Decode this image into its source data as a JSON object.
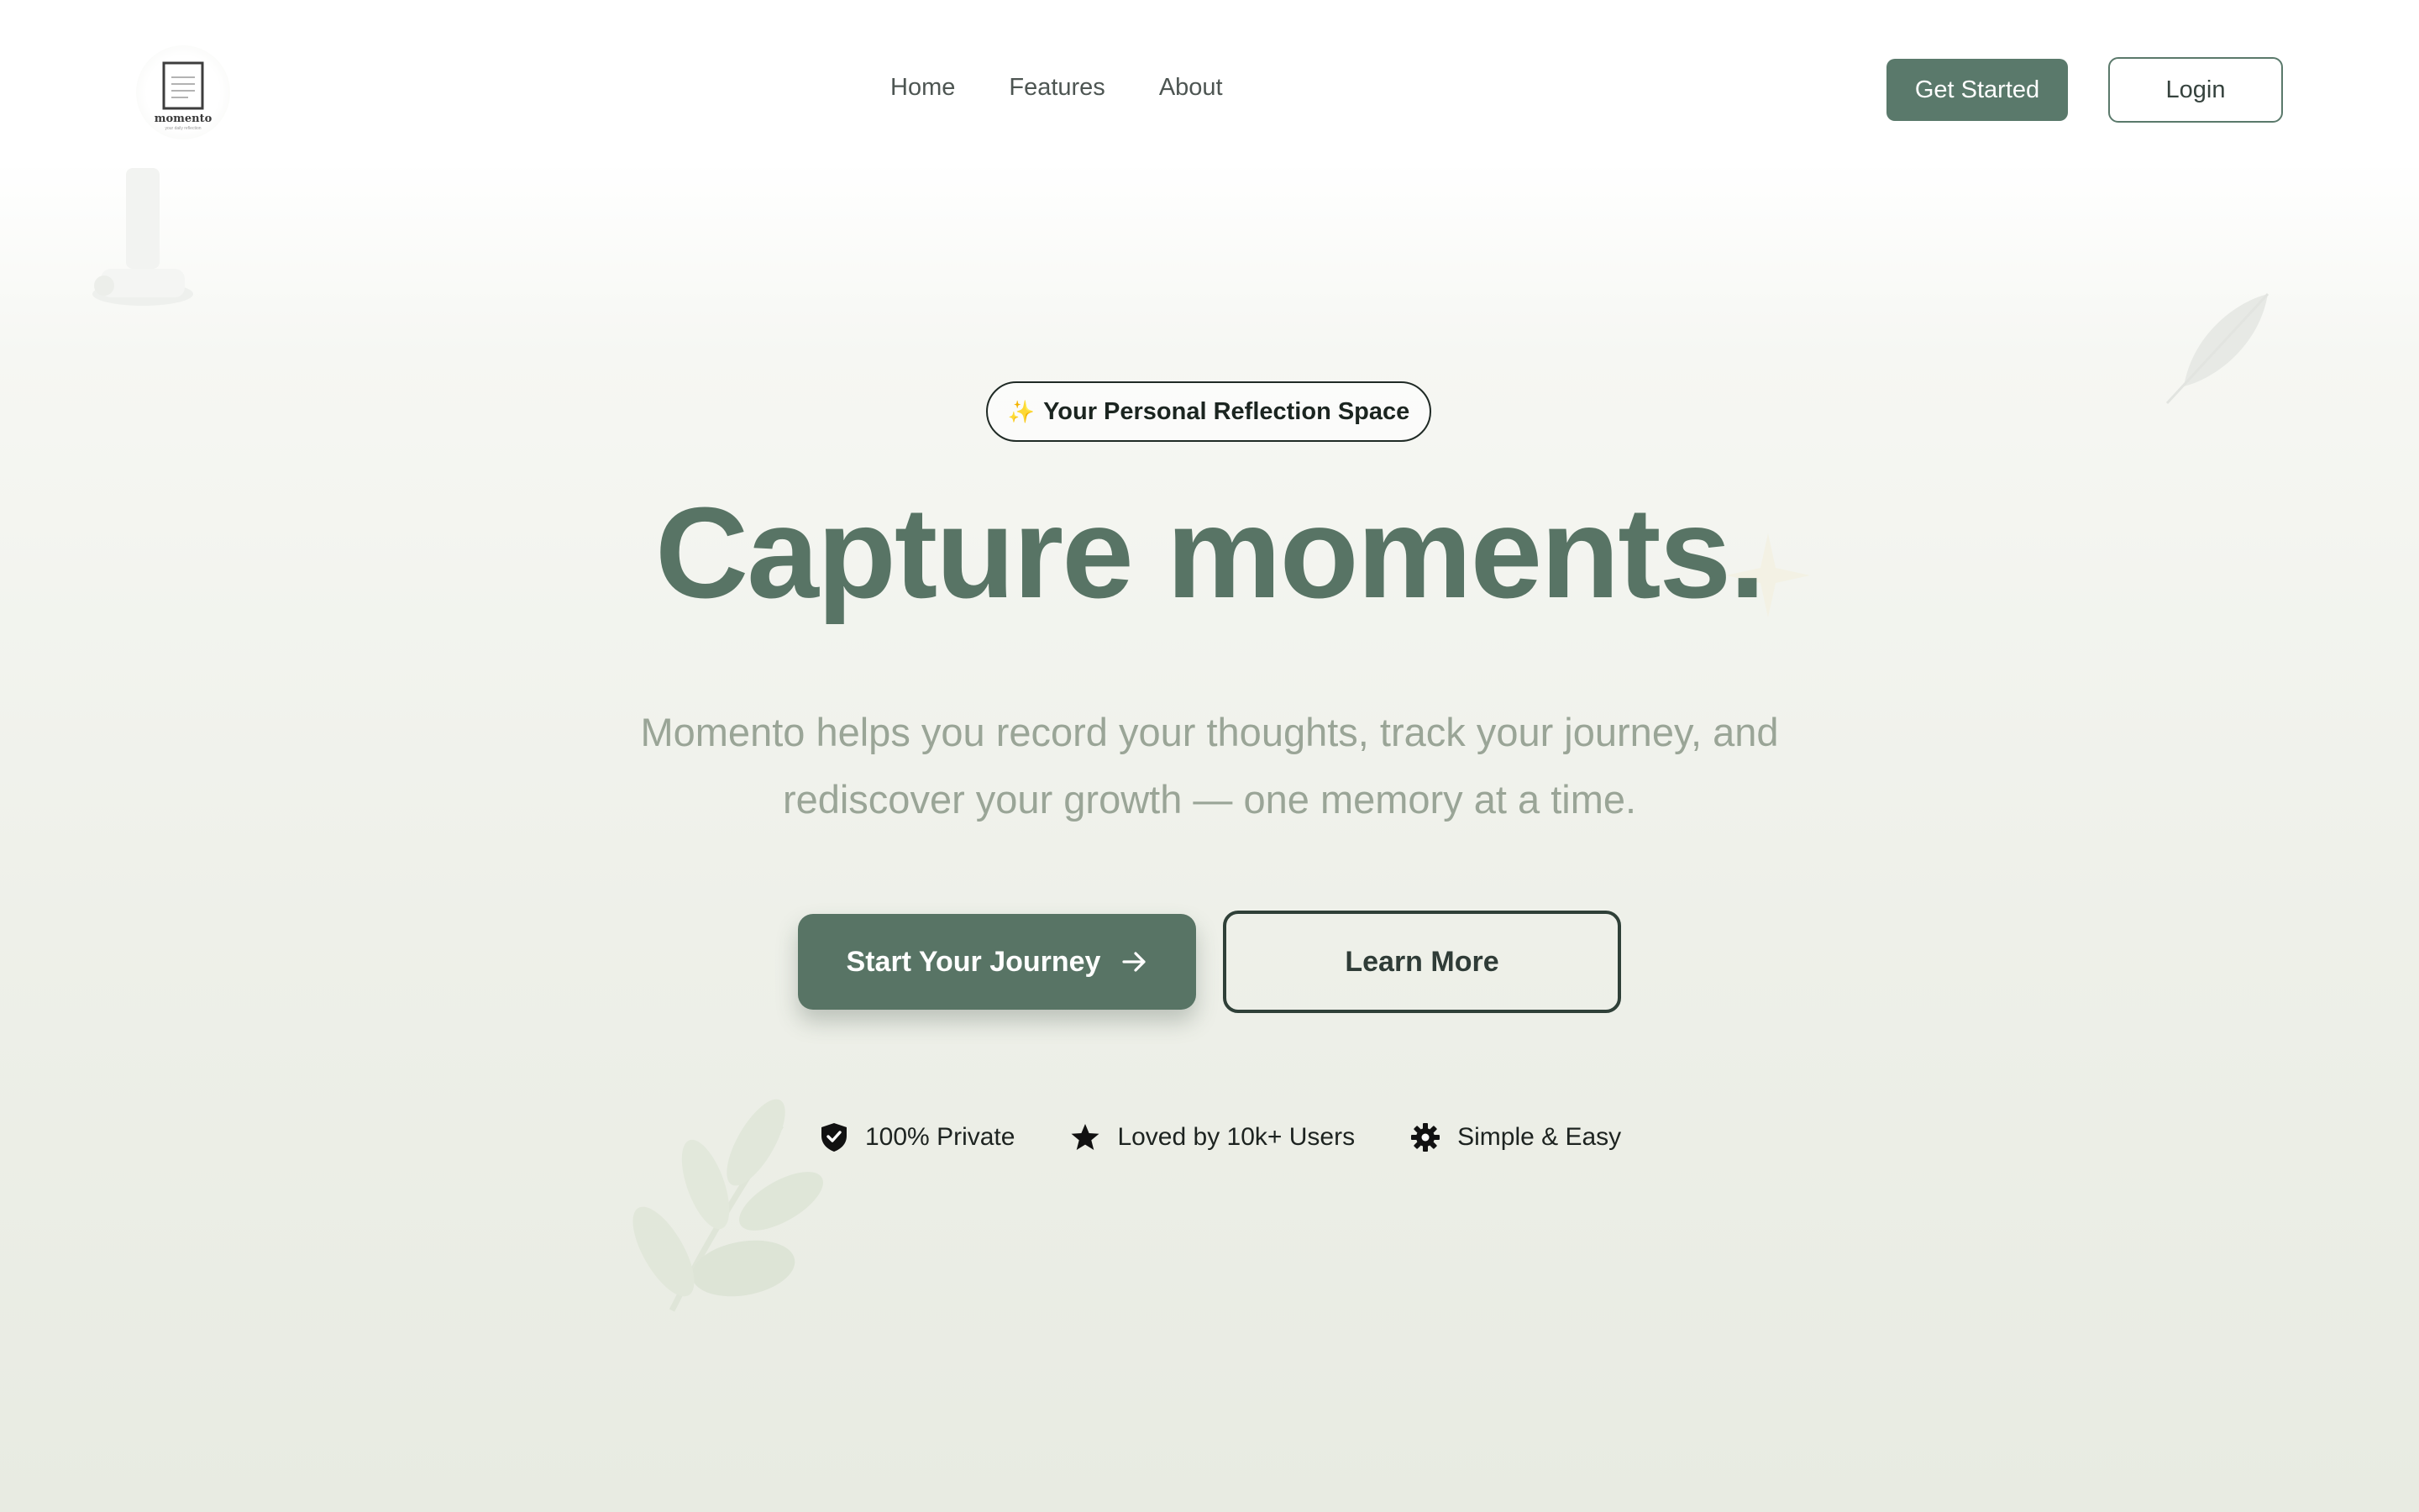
{
  "header": {
    "logo": {
      "name": "momento",
      "tagline": "your daily reflection"
    },
    "nav": [
      "Home",
      "Features",
      "About"
    ],
    "get_started_label": "Get Started",
    "login_label": "Login"
  },
  "hero": {
    "badge": {
      "icon": "sparkles-icon",
      "text": "Your Personal Reflection Space"
    },
    "headline": "Capture moments.",
    "subtitle_line1": "Momento helps you record your thoughts, track your journey, and",
    "subtitle_line2": "rediscover your growth — one memory at a time.",
    "primary_cta": "Start Your Journey",
    "secondary_cta": "Learn More",
    "features": [
      {
        "icon": "shield-check-icon",
        "label": "100% Private"
      },
      {
        "icon": "star-icon",
        "label": "Loved by 10k+ Users"
      },
      {
        "icon": "gear-icon",
        "label": "Simple & Easy"
      }
    ]
  },
  "colors": {
    "brand": "#587465",
    "subtitle": "#9aa597",
    "background_top": "#ffffff",
    "background_bottom": "#e8ebe2"
  }
}
